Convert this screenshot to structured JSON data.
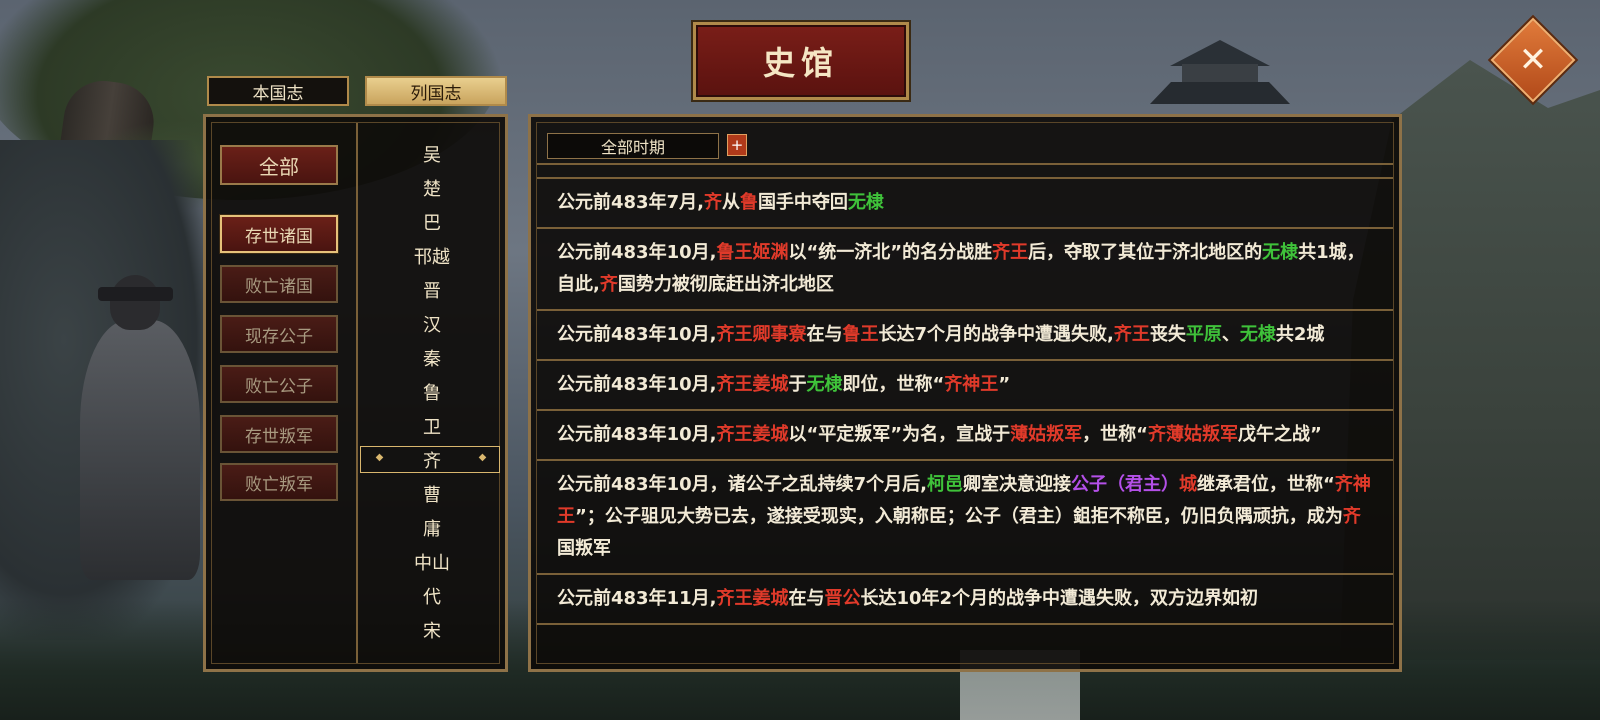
{
  "title": "史馆",
  "tabs": [
    {
      "label": "本国志",
      "active": false
    },
    {
      "label": "列国志",
      "active": true
    }
  ],
  "categories": [
    {
      "label": "全部",
      "style": "all"
    },
    {
      "label": "存世诸国",
      "style": "active"
    },
    {
      "label": "败亡诸国",
      "style": "dim"
    },
    {
      "label": "现存公子",
      "style": "dim"
    },
    {
      "label": "败亡公子",
      "style": "dim"
    },
    {
      "label": "存世叛军",
      "style": "dim"
    },
    {
      "label": "败亡叛军",
      "style": "dim"
    }
  ],
  "countries": [
    "吴",
    "楚",
    "巴",
    "邗越",
    "晋",
    "汉",
    "秦",
    "鲁",
    "卫",
    "齐",
    "曹",
    "庸",
    "中山",
    "代",
    "宋"
  ],
  "selected_country": "齐",
  "filter": {
    "label": "全部时期",
    "add_label": "+"
  },
  "colors": {
    "red": "#e03a2a",
    "green": "#3fc23a",
    "purple": "#b450e8",
    "text": "#f2ead6"
  },
  "entries": [
    [
      [
        "公元前483年7月,",
        ""
      ],
      [
        "齐",
        "r"
      ],
      [
        "从",
        ""
      ],
      [
        "鲁",
        "r"
      ],
      [
        "国手中夺回",
        ""
      ],
      [
        "无棣",
        "g"
      ]
    ],
    [
      [
        "公元前483年10月,",
        ""
      ],
      [
        "鲁王姬渊",
        "r"
      ],
      [
        "以“统一济北”的名分战胜",
        ""
      ],
      [
        "齐王",
        "r"
      ],
      [
        "后，夺取了其位于济北地区的",
        ""
      ],
      [
        "无棣",
        "g"
      ],
      [
        "共1城，自此,",
        ""
      ],
      [
        "齐",
        "r"
      ],
      [
        "国势力被彻底赶出济北地区",
        ""
      ]
    ],
    [
      [
        "公元前483年10月,",
        ""
      ],
      [
        "齐王卿事寮",
        "r"
      ],
      [
        "在与",
        ""
      ],
      [
        "鲁王",
        "r"
      ],
      [
        "长达7个月的战争中遭遇失败,",
        ""
      ],
      [
        "齐王",
        "r"
      ],
      [
        "丧失",
        ""
      ],
      [
        "平原",
        "g"
      ],
      [
        "、",
        ""
      ],
      [
        "无棣",
        "g"
      ],
      [
        "共2城",
        ""
      ]
    ],
    [
      [
        "公元前483年10月,",
        ""
      ],
      [
        "齐王姜城",
        "r"
      ],
      [
        "于",
        ""
      ],
      [
        "无棣",
        "g"
      ],
      [
        "即位，世称“",
        ""
      ],
      [
        "齐神王",
        "r"
      ],
      [
        "”",
        ""
      ]
    ],
    [
      [
        "公元前483年10月,",
        ""
      ],
      [
        "齐王姜城",
        "r"
      ],
      [
        "以“平定叛军”为名，宣战于",
        ""
      ],
      [
        "薄姑叛军",
        "r"
      ],
      [
        "，世称“",
        ""
      ],
      [
        "齐薄姑叛军",
        "r"
      ],
      [
        "戊午之战”",
        ""
      ]
    ],
    [
      [
        "公元前483年10月，诸公子之乱持续7个月后,",
        ""
      ],
      [
        "柯邑",
        "g"
      ],
      [
        "卿室决意迎接",
        ""
      ],
      [
        "公子（君主）",
        "p"
      ],
      [
        "城",
        "r"
      ],
      [
        "继承君位，世称“",
        ""
      ],
      [
        "齐神王",
        "r"
      ],
      [
        "”；公子驵见大势已去，遂接受现实，入朝称臣；公子（君主）鉏拒不称臣，仍旧负隅顽抗，成为",
        ""
      ],
      [
        "齐",
        "r"
      ],
      [
        "国叛军",
        ""
      ]
    ],
    [
      [
        "公元前483年11月,",
        ""
      ],
      [
        "齐王姜城",
        "r"
      ],
      [
        "在与",
        ""
      ],
      [
        "晋公",
        "r"
      ],
      [
        "长达10年2个月的战争中遭遇失败，双方边界如初",
        ""
      ]
    ]
  ]
}
